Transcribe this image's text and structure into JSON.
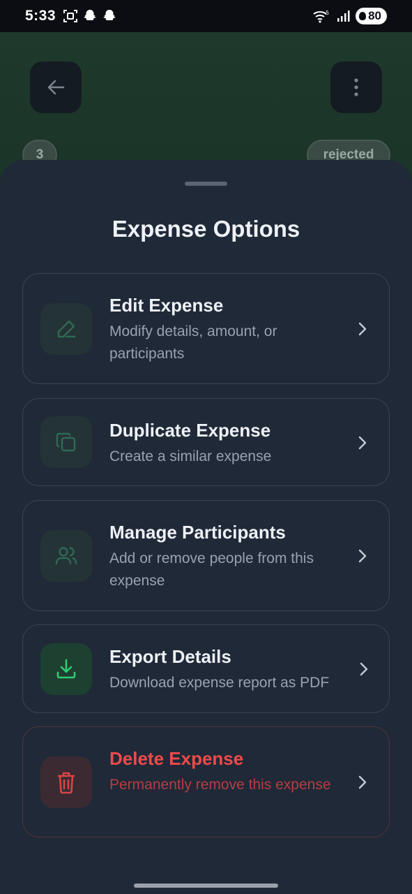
{
  "status_bar": {
    "time": "5:33",
    "battery": "80",
    "icons": [
      "screenshot-icon",
      "snapchat-icon",
      "snapchat-icon",
      "wifi-icon",
      "signal-icon",
      "battery-icon"
    ]
  },
  "background": {
    "count_chip": "3",
    "status_chip": "rejected"
  },
  "sheet": {
    "title": "Expense Options",
    "options": [
      {
        "title": "Edit Expense",
        "description": "Modify details, amount, or participants",
        "icon": "pencil-icon"
      },
      {
        "title": "Duplicate Expense",
        "description": "Create a similar expense",
        "icon": "copy-icon"
      },
      {
        "title": "Manage Participants",
        "description": "Add or remove people from this expense",
        "icon": "users-icon"
      },
      {
        "title": "Export Details",
        "description": "Download expense report as PDF",
        "icon": "download-icon"
      },
      {
        "title": "Delete Expense",
        "description": "Permanently remove this expense",
        "icon": "trash-icon"
      }
    ]
  },
  "colors": {
    "sheet_bg": "#1f2937",
    "accent_green": "#2ecc71",
    "danger_red": "#ef4a4a",
    "muted_icon": "#2f5a4a"
  }
}
